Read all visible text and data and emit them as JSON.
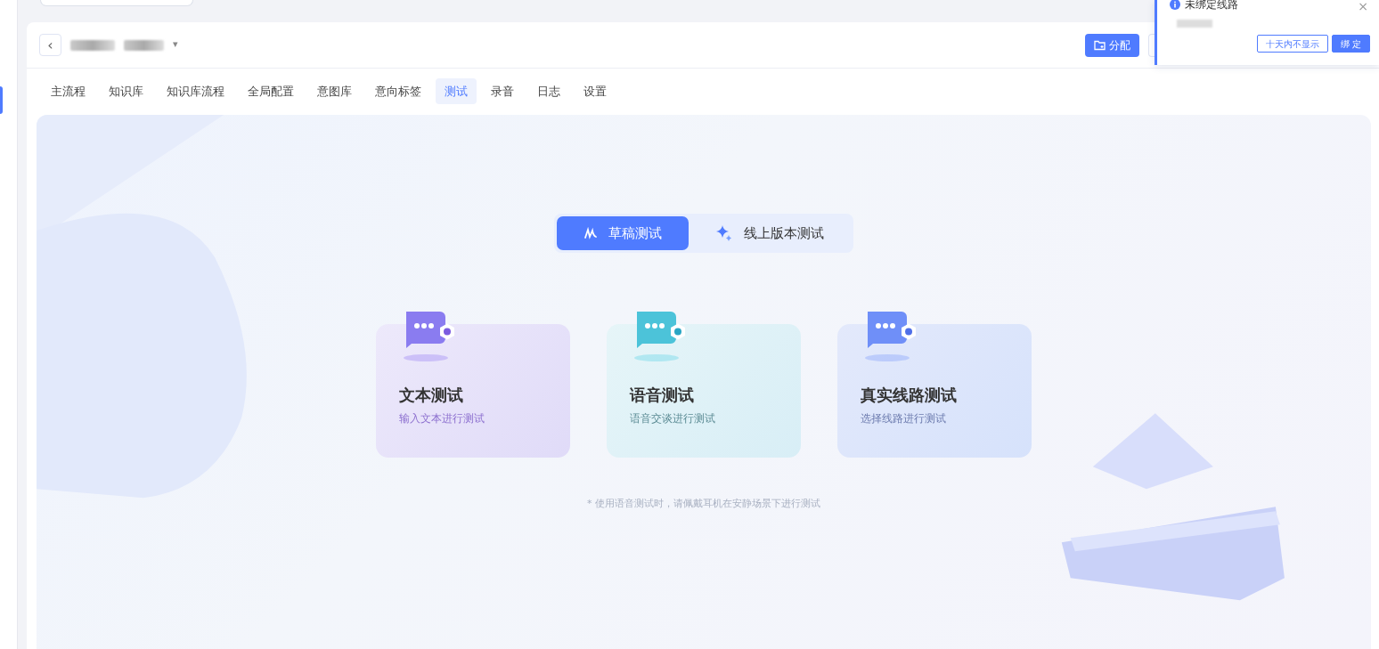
{
  "header": {
    "back": "‹",
    "caret": "▾",
    "assign_button": "分配"
  },
  "tabs": [
    {
      "label": "主流程",
      "selected": false
    },
    {
      "label": "知识库",
      "selected": false
    },
    {
      "label": "知识库流程",
      "selected": false
    },
    {
      "label": "全局配置",
      "selected": false
    },
    {
      "label": "意图库",
      "selected": false
    },
    {
      "label": "意向标签",
      "selected": false
    },
    {
      "label": "测试",
      "selected": true
    },
    {
      "label": "录音",
      "selected": false
    },
    {
      "label": "日志",
      "selected": false
    },
    {
      "label": "设置",
      "selected": false
    }
  ],
  "mode_switch": [
    {
      "label": "草稿测试",
      "selected": true,
      "kind": "draft"
    },
    {
      "label": "线上版本测试",
      "selected": false,
      "kind": "online"
    }
  ],
  "test_cards": [
    {
      "title": "文本测试",
      "subtitle": "输入文本进行测试",
      "kind": "text"
    },
    {
      "title": "语音测试",
      "subtitle": "语音交谈进行测试",
      "kind": "voice"
    },
    {
      "title": "真实线路测试",
      "subtitle": "选择线路进行测试",
      "kind": "line"
    }
  ],
  "note": "* 使用语音测试时，请佩戴耳机在安静场景下进行测试",
  "notification": {
    "title": "未绑定线路",
    "close": "×",
    "buttons": [
      {
        "label": "十天内不显示",
        "kind": "outline"
      },
      {
        "label": "绑 定",
        "kind": "primary"
      }
    ]
  }
}
